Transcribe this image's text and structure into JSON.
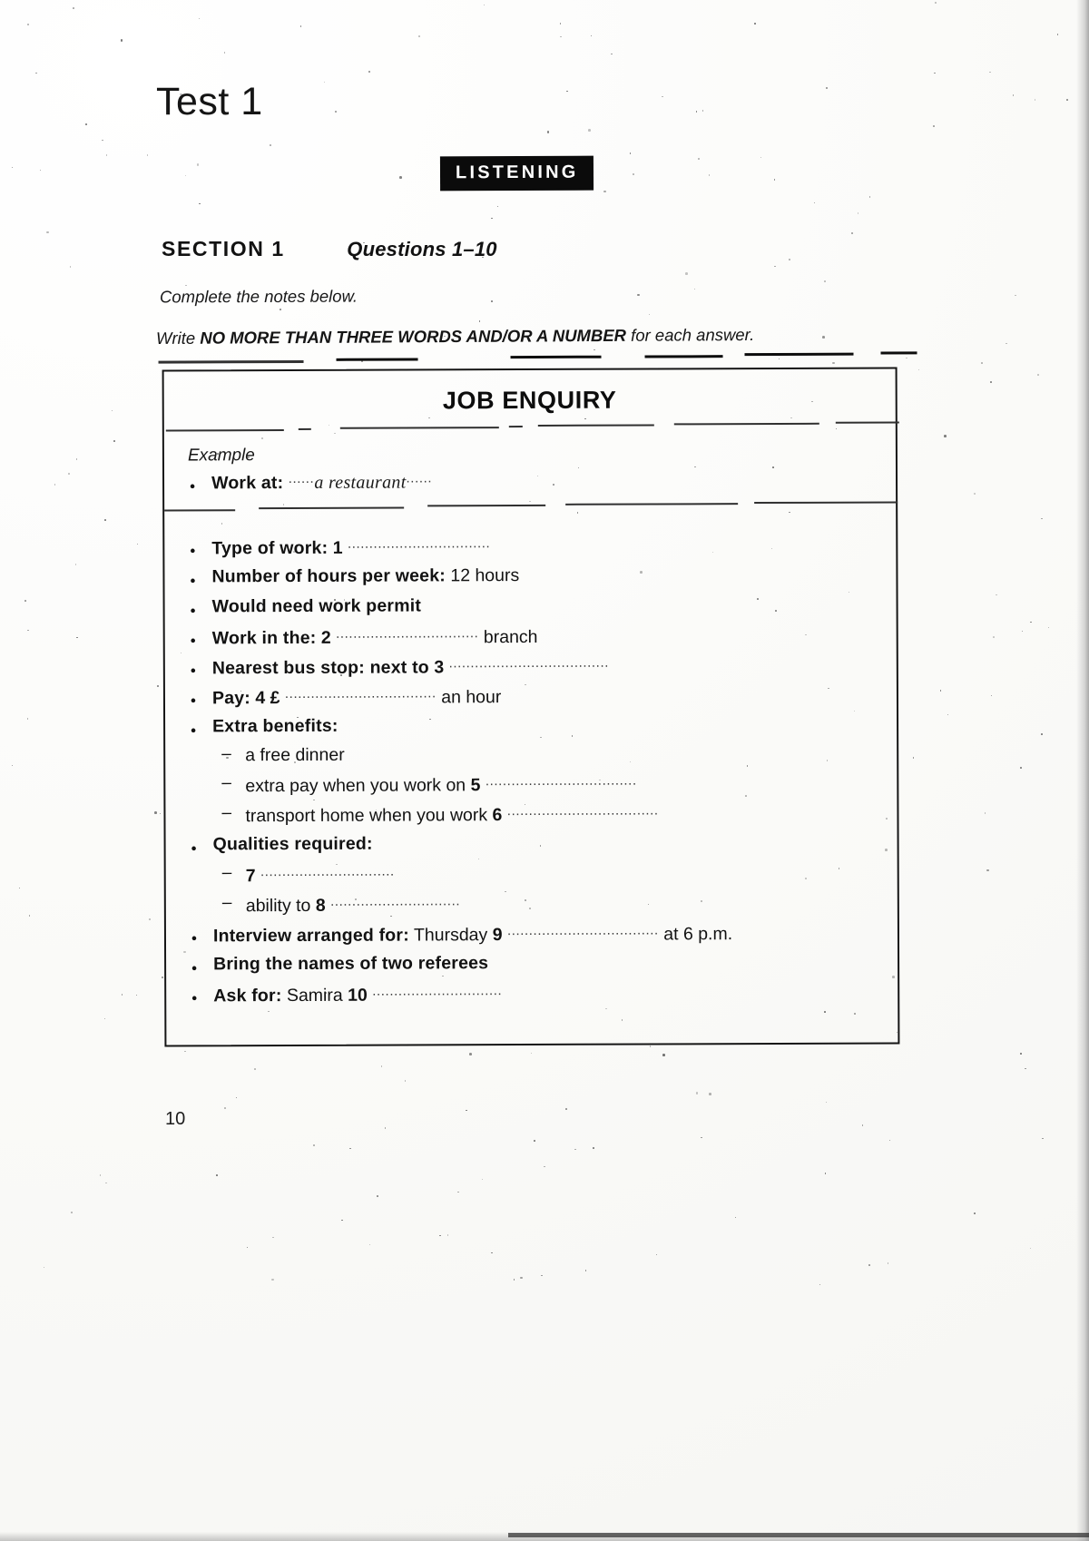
{
  "document": {
    "test_title": "Test 1",
    "badge": "LISTENING",
    "section_label": "SECTION 1",
    "questions_label": "Questions 1–10",
    "instruction_1": "Complete the notes below.",
    "instruction_2_prefix": "Write ",
    "instruction_2_bold": "NO MORE THAN THREE WORDS AND/OR A NUMBER",
    "instruction_2_suffix": " for each answer.",
    "page_number": "10"
  },
  "notes_box": {
    "title": "JOB ENQUIRY",
    "example_label": "Example",
    "example": {
      "label": "Work at:",
      "answer": "a restaurant",
      "dots_before": "......",
      "dots_after": "......"
    },
    "items": [
      {
        "id": "type-of-work",
        "marker": "bullet",
        "label": "Type of work:",
        "number": "1",
        "dots": ".................................",
        "suffix": ""
      },
      {
        "id": "hours-per-week",
        "marker": "bullet",
        "label": "Number of hours per week:",
        "number": "",
        "dots": "",
        "suffix": "12 hours"
      },
      {
        "id": "work-permit",
        "marker": "bullet",
        "label": "Would need work permit",
        "number": "",
        "dots": "",
        "suffix": ""
      },
      {
        "id": "work-in-the",
        "marker": "bullet",
        "label": "Work in the:",
        "number": "2",
        "dots": ".................................",
        "suffix": "branch"
      },
      {
        "id": "nearest-bus-stop",
        "marker": "bullet",
        "label": "Nearest bus stop: next to",
        "number": "3",
        "dots": ".....................................",
        "suffix": ""
      },
      {
        "id": "pay",
        "marker": "bullet",
        "label": "Pay:",
        "number": "4 £",
        "dots": "...................................",
        "suffix": "an hour"
      },
      {
        "id": "extra-benefits",
        "marker": "bullet",
        "label": "Extra benefits:",
        "number": "",
        "dots": "",
        "suffix": ""
      },
      {
        "id": "free-dinner",
        "marker": "dash",
        "label": "",
        "prefix": "a free dinner",
        "number": "",
        "dots": "",
        "suffix": ""
      },
      {
        "id": "extra-pay",
        "marker": "dash",
        "label": "",
        "prefix": "extra pay when you work on",
        "number": "5",
        "dots": "...................................",
        "suffix": ""
      },
      {
        "id": "transport-home",
        "marker": "dash",
        "label": "",
        "prefix": "transport home when you work",
        "number": "6",
        "dots": "...................................",
        "suffix": ""
      },
      {
        "id": "qualities-required",
        "marker": "bullet",
        "label": "Qualities required:",
        "number": "",
        "dots": "",
        "suffix": ""
      },
      {
        "id": "quality-7",
        "marker": "dash",
        "label": "",
        "prefix": "",
        "number": "7",
        "dots": "...............................",
        "suffix": ""
      },
      {
        "id": "ability-to",
        "marker": "dash",
        "label": "",
        "prefix": "ability to",
        "number": "8",
        "dots": "..............................",
        "suffix": ""
      },
      {
        "id": "interview-arranged",
        "marker": "bullet",
        "label": "Interview arranged for:",
        "prefix": "Thursday",
        "number": "9",
        "dots": "...................................",
        "suffix": "at 6 p.m."
      },
      {
        "id": "bring-referees",
        "marker": "bullet",
        "label": "Bring the names of two referees",
        "number": "",
        "dots": "",
        "suffix": ""
      },
      {
        "id": "ask-for",
        "marker": "bullet",
        "label": "Ask for:",
        "prefix": "Samira",
        "number": "10",
        "dots": "..............................",
        "suffix": ""
      }
    ]
  },
  "colors": {
    "ink": "#121212",
    "badge_bg": "#0b0b0b",
    "badge_text": "#ffffff",
    "paper": "#fdfdfb"
  }
}
